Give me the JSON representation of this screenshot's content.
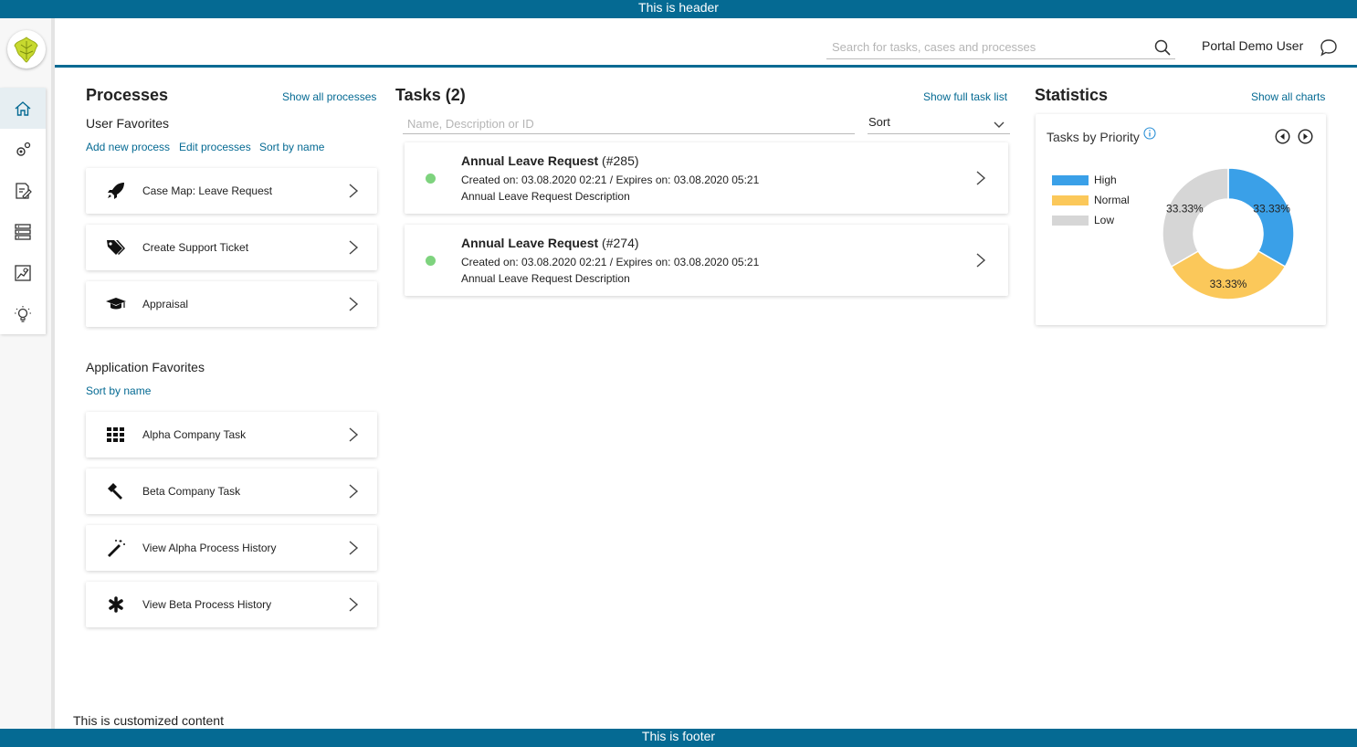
{
  "header_banner": "This is header",
  "footer_banner": "This is footer",
  "custom_content": "This is customized content",
  "topbar": {
    "search_placeholder": "Search for tasks, cases and processes",
    "user_name": "Portal Demo User"
  },
  "sidebar": {
    "items": [
      {
        "icon": "home-icon",
        "active": true
      },
      {
        "icon": "processes-icon",
        "active": false
      },
      {
        "icon": "tasks-icon",
        "active": false
      },
      {
        "icon": "cases-icon",
        "active": false
      },
      {
        "icon": "statistics-icon",
        "active": false
      },
      {
        "icon": "lightbulb-icon",
        "active": false
      }
    ]
  },
  "processes": {
    "title": "Processes",
    "show_all": "Show all processes",
    "user_favorites_title": "User Favorites",
    "add_new": "Add new process",
    "edit": "Edit processes",
    "sort_by_name": "Sort by name",
    "user_favorites": [
      {
        "label": "Case Map: Leave Request",
        "icon": "rocket-icon"
      },
      {
        "label": "Create Support Ticket",
        "icon": "tags-icon"
      },
      {
        "label": "Appraisal",
        "icon": "graduation-cap-icon"
      }
    ],
    "app_favorites_title": "Application Favorites",
    "app_sort_by_name": "Sort by name",
    "app_favorites": [
      {
        "label": "Alpha Company Task",
        "icon": "grid-icon"
      },
      {
        "label": "Beta Company Task",
        "icon": "gavel-icon"
      },
      {
        "label": "View Alpha Process History",
        "icon": "magic-wand-icon"
      },
      {
        "label": "View Beta Process History",
        "icon": "asterisk-icon"
      }
    ]
  },
  "tasks": {
    "title": "Tasks (2)",
    "show_full": "Show full task list",
    "filter_placeholder": "Name, Description or ID",
    "sort_label": "Sort",
    "items": [
      {
        "name": "Annual Leave Request",
        "id": "(#285)",
        "dates": "Created on: 03.08.2020 02:21 / Expires on: 03.08.2020 05:21",
        "description": "Annual Leave Request Description"
      },
      {
        "name": "Annual Leave Request",
        "id": "(#274)",
        "dates": "Created on: 03.08.2020 02:21 / Expires on: 03.08.2020 05:21",
        "description": "Annual Leave Request Description"
      }
    ]
  },
  "statistics": {
    "title": "Statistics",
    "show_all": "Show all charts",
    "chart_data": {
      "type": "pie",
      "title": "Tasks by Priority",
      "categories": [
        "High",
        "Normal",
        "Low"
      ],
      "values": [
        33.33,
        33.33,
        33.33
      ],
      "data_labels": [
        "33.33%",
        "33.33%",
        "33.33%"
      ],
      "colors": [
        "#3aa0e8",
        "#fbc85a",
        "#d6d6d6"
      ],
      "donut": true,
      "legend": "left"
    }
  }
}
